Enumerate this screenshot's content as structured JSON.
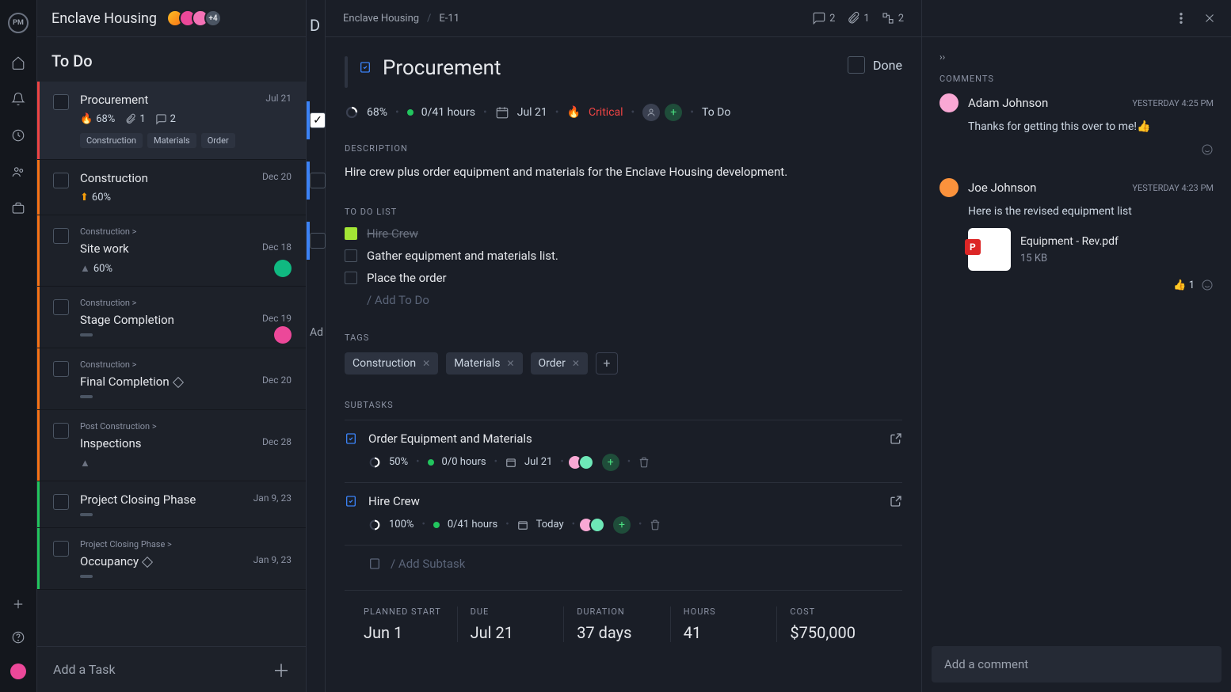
{
  "project": {
    "title": "Enclave Housing",
    "avatar_more": "+4"
  },
  "column_title": "To Do",
  "shadow_column_header": "D",
  "shadow_add_label": "Ad",
  "add_task_label": "Add a Task",
  "tasks": [
    {
      "title": "Procurement",
      "date": "Jul 21",
      "pct": "68%",
      "attach": "1",
      "comments": "2",
      "tags": [
        "Construction",
        "Materials",
        "Order"
      ],
      "priority": "fire",
      "edge": "#ef4444",
      "selected": true
    },
    {
      "title": "Construction",
      "date": "Dec 20",
      "pct": "60%",
      "priority": "up",
      "edge": "#f97316"
    },
    {
      "breadcrumb": "Construction >",
      "title": "Site work",
      "date": "Dec 18",
      "pct": "60%",
      "priority": "tri",
      "edge": "#f97316",
      "avatar": "#10b981"
    },
    {
      "breadcrumb": "Construction >",
      "title": "Stage Completion",
      "date": "Dec 19",
      "bar": true,
      "edge": "#f97316",
      "avatar": "#ec4899"
    },
    {
      "breadcrumb": "Construction >",
      "title": "Final Completion",
      "diamond": true,
      "date": "Dec 20",
      "bar": true,
      "edge": "#f97316"
    },
    {
      "breadcrumb": "Post Construction >",
      "title": "Inspections",
      "date": "Dec 28",
      "priority": "tri",
      "edge": "#f97316"
    },
    {
      "title": "Project Closing Phase",
      "date": "Jan 9, 23",
      "bar": true,
      "edge": "#22c55e"
    },
    {
      "breadcrumb": "Project Closing Phase >",
      "title": "Occupancy",
      "diamond": true,
      "date": "Jan 9, 23",
      "bar": true,
      "edge": "#22c55e"
    }
  ],
  "detail": {
    "breadcrumb_project": "Enclave Housing",
    "breadcrumb_id": "E-11",
    "counts": {
      "comments": "2",
      "attachments": "1",
      "subtasks": "2"
    },
    "title": "Procurement",
    "done_label": "Done",
    "pct": "68%",
    "hours": "0",
    "hours_total": "41 hours",
    "due": "Jul 21",
    "priority": "Critical",
    "status": "To Do",
    "desc_label": "DESCRIPTION",
    "description": "Hire crew plus order equipment and materials for the Enclave Housing development.",
    "todo_label": "TO DO LIST",
    "todos": [
      {
        "text": "Hire Crew",
        "done": true
      },
      {
        "text": "Gather equipment and materials list.",
        "done": false
      },
      {
        "text": "Place the order",
        "done": false
      }
    ],
    "add_todo_placeholder": "/ Add To Do",
    "tags_label": "TAGS",
    "tags": [
      "Construction",
      "Materials",
      "Order"
    ],
    "subtasks_label": "SUBTASKS",
    "subtasks": [
      {
        "title": "Order Equipment and Materials",
        "pct": "50%",
        "hours": "0",
        "hours_total": "0 hours",
        "due": "Jul 21"
      },
      {
        "title": "Hire Crew",
        "pct": "100%",
        "hours": "0",
        "hours_total": "41 hours",
        "due": "Today"
      }
    ],
    "add_subtask_placeholder": "/ Add Subtask",
    "stats": {
      "planned_start": {
        "label": "PLANNED START",
        "value": "Jun 1"
      },
      "due": {
        "label": "DUE",
        "value": "Jul 21"
      },
      "duration": {
        "label": "DURATION",
        "value": "37 days"
      },
      "hours": {
        "label": "HOURS",
        "value": "41"
      },
      "cost": {
        "label": "COST",
        "value": "$750,000"
      }
    }
  },
  "comments": {
    "label": "COMMENTS",
    "items": [
      {
        "author": "Adam Johnson",
        "time": "YESTERDAY 4:25 PM",
        "text": "Thanks for getting this over to me!👍",
        "avatar": "#f9a8d4"
      },
      {
        "author": "Joe Johnson",
        "time": "YESTERDAY 4:23 PM",
        "text": "Here is the revised equipment list",
        "avatar": "#fb923c",
        "attachment": {
          "name": "Equipment - Rev.pdf",
          "size": "15 KB"
        },
        "reactions": {
          "emoji": "👍",
          "count": "1"
        }
      }
    ],
    "input_placeholder": "Add a comment"
  }
}
